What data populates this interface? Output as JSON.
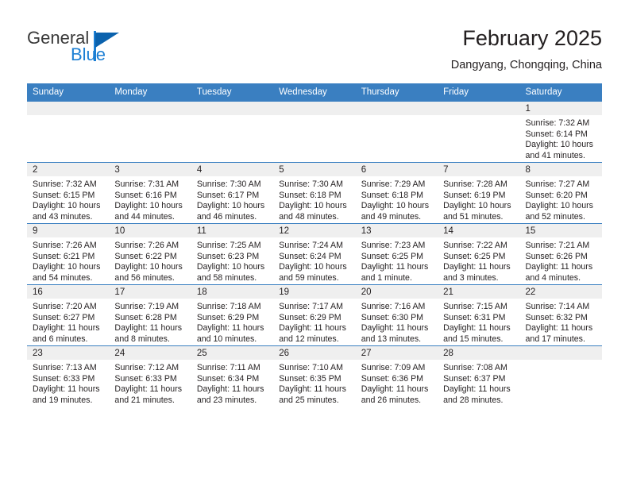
{
  "brand": {
    "name_part1": "General",
    "name_part2": "Blue",
    "accent_color": "#1c7fd4",
    "triangle_color": "#0b62ad"
  },
  "header": {
    "month_title": "February 2025",
    "location": "Dangyang, Chongqing, China"
  },
  "theme": {
    "header_row_bg": "#3a7fc1",
    "daynum_strip_bg": "#efefef",
    "text_color": "#231f20"
  },
  "calendar": {
    "weekday_headers": [
      "Sunday",
      "Monday",
      "Tuesday",
      "Wednesday",
      "Thursday",
      "Friday",
      "Saturday"
    ],
    "weeks": [
      [
        {
          "day": "",
          "lines": []
        },
        {
          "day": "",
          "lines": []
        },
        {
          "day": "",
          "lines": []
        },
        {
          "day": "",
          "lines": []
        },
        {
          "day": "",
          "lines": []
        },
        {
          "day": "",
          "lines": []
        },
        {
          "day": "1",
          "lines": [
            "Sunrise: 7:32 AM",
            "Sunset: 6:14 PM",
            "Daylight: 10 hours",
            "and 41 minutes."
          ]
        }
      ],
      [
        {
          "day": "2",
          "lines": [
            "Sunrise: 7:32 AM",
            "Sunset: 6:15 PM",
            "Daylight: 10 hours",
            "and 43 minutes."
          ]
        },
        {
          "day": "3",
          "lines": [
            "Sunrise: 7:31 AM",
            "Sunset: 6:16 PM",
            "Daylight: 10 hours",
            "and 44 minutes."
          ]
        },
        {
          "day": "4",
          "lines": [
            "Sunrise: 7:30 AM",
            "Sunset: 6:17 PM",
            "Daylight: 10 hours",
            "and 46 minutes."
          ]
        },
        {
          "day": "5",
          "lines": [
            "Sunrise: 7:30 AM",
            "Sunset: 6:18 PM",
            "Daylight: 10 hours",
            "and 48 minutes."
          ]
        },
        {
          "day": "6",
          "lines": [
            "Sunrise: 7:29 AM",
            "Sunset: 6:18 PM",
            "Daylight: 10 hours",
            "and 49 minutes."
          ]
        },
        {
          "day": "7",
          "lines": [
            "Sunrise: 7:28 AM",
            "Sunset: 6:19 PM",
            "Daylight: 10 hours",
            "and 51 minutes."
          ]
        },
        {
          "day": "8",
          "lines": [
            "Sunrise: 7:27 AM",
            "Sunset: 6:20 PM",
            "Daylight: 10 hours",
            "and 52 minutes."
          ]
        }
      ],
      [
        {
          "day": "9",
          "lines": [
            "Sunrise: 7:26 AM",
            "Sunset: 6:21 PM",
            "Daylight: 10 hours",
            "and 54 minutes."
          ]
        },
        {
          "day": "10",
          "lines": [
            "Sunrise: 7:26 AM",
            "Sunset: 6:22 PM",
            "Daylight: 10 hours",
            "and 56 minutes."
          ]
        },
        {
          "day": "11",
          "lines": [
            "Sunrise: 7:25 AM",
            "Sunset: 6:23 PM",
            "Daylight: 10 hours",
            "and 58 minutes."
          ]
        },
        {
          "day": "12",
          "lines": [
            "Sunrise: 7:24 AM",
            "Sunset: 6:24 PM",
            "Daylight: 10 hours",
            "and 59 minutes."
          ]
        },
        {
          "day": "13",
          "lines": [
            "Sunrise: 7:23 AM",
            "Sunset: 6:25 PM",
            "Daylight: 11 hours",
            "and 1 minute."
          ]
        },
        {
          "day": "14",
          "lines": [
            "Sunrise: 7:22 AM",
            "Sunset: 6:25 PM",
            "Daylight: 11 hours",
            "and 3 minutes."
          ]
        },
        {
          "day": "15",
          "lines": [
            "Sunrise: 7:21 AM",
            "Sunset: 6:26 PM",
            "Daylight: 11 hours",
            "and 4 minutes."
          ]
        }
      ],
      [
        {
          "day": "16",
          "lines": [
            "Sunrise: 7:20 AM",
            "Sunset: 6:27 PM",
            "Daylight: 11 hours",
            "and 6 minutes."
          ]
        },
        {
          "day": "17",
          "lines": [
            "Sunrise: 7:19 AM",
            "Sunset: 6:28 PM",
            "Daylight: 11 hours",
            "and 8 minutes."
          ]
        },
        {
          "day": "18",
          "lines": [
            "Sunrise: 7:18 AM",
            "Sunset: 6:29 PM",
            "Daylight: 11 hours",
            "and 10 minutes."
          ]
        },
        {
          "day": "19",
          "lines": [
            "Sunrise: 7:17 AM",
            "Sunset: 6:29 PM",
            "Daylight: 11 hours",
            "and 12 minutes."
          ]
        },
        {
          "day": "20",
          "lines": [
            "Sunrise: 7:16 AM",
            "Sunset: 6:30 PM",
            "Daylight: 11 hours",
            "and 13 minutes."
          ]
        },
        {
          "day": "21",
          "lines": [
            "Sunrise: 7:15 AM",
            "Sunset: 6:31 PM",
            "Daylight: 11 hours",
            "and 15 minutes."
          ]
        },
        {
          "day": "22",
          "lines": [
            "Sunrise: 7:14 AM",
            "Sunset: 6:32 PM",
            "Daylight: 11 hours",
            "and 17 minutes."
          ]
        }
      ],
      [
        {
          "day": "23",
          "lines": [
            "Sunrise: 7:13 AM",
            "Sunset: 6:33 PM",
            "Daylight: 11 hours",
            "and 19 minutes."
          ]
        },
        {
          "day": "24",
          "lines": [
            "Sunrise: 7:12 AM",
            "Sunset: 6:33 PM",
            "Daylight: 11 hours",
            "and 21 minutes."
          ]
        },
        {
          "day": "25",
          "lines": [
            "Sunrise: 7:11 AM",
            "Sunset: 6:34 PM",
            "Daylight: 11 hours",
            "and 23 minutes."
          ]
        },
        {
          "day": "26",
          "lines": [
            "Sunrise: 7:10 AM",
            "Sunset: 6:35 PM",
            "Daylight: 11 hours",
            "and 25 minutes."
          ]
        },
        {
          "day": "27",
          "lines": [
            "Sunrise: 7:09 AM",
            "Sunset: 6:36 PM",
            "Daylight: 11 hours",
            "and 26 minutes."
          ]
        },
        {
          "day": "28",
          "lines": [
            "Sunrise: 7:08 AM",
            "Sunset: 6:37 PM",
            "Daylight: 11 hours",
            "and 28 minutes."
          ]
        },
        {
          "day": "",
          "lines": []
        }
      ]
    ]
  }
}
